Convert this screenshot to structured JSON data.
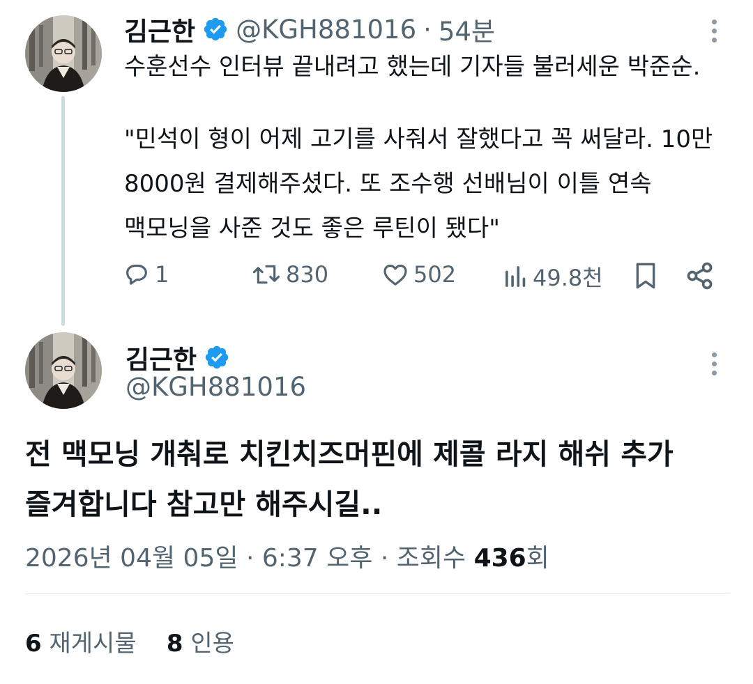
{
  "parent_tweet": {
    "author_name": "김근한",
    "handle": "@KGH881016",
    "separator": "·",
    "time_ago": "54분",
    "text_line1": "수훈선수 인터뷰 끝내려고 했는데 기자들 불러세운 박준순.",
    "text_line2": "\"민석이 형이 어제 고기를 사줘서 잘했다고 꼭 써달라. 10만",
    "text_line3": "8000원 결제해주셨다. 또 조수행 선배님이 이틀 연속",
    "text_line4": "맥모닝을 사준 것도 좋은 루틴이 됐다\"",
    "replies": "1",
    "retweets": "830",
    "likes": "502",
    "views": "49.8천"
  },
  "main_tweet": {
    "author_name": "김근한",
    "handle": "@KGH881016",
    "text_line1": "전 맥모닝 개춰로 치킨치즈머핀에 제콜 라지 해쉬 추가",
    "text_line2": "즐겨합니다 참고만 해주시길..",
    "date": "2026년 04월 05일",
    "sep1": "·",
    "time": "6:37 오후",
    "sep2": "·",
    "views_label": "조회수",
    "views_count": "436",
    "views_unit": "회"
  },
  "stats": {
    "reposts_count": "6",
    "reposts_label": "재게시물",
    "quotes_count": "8",
    "quotes_label": "인용"
  },
  "colors": {
    "verified": "#1d9bf0",
    "secondary_text": "#536471",
    "primary_text": "#0f1419",
    "thread_line": "#cfd9de"
  }
}
